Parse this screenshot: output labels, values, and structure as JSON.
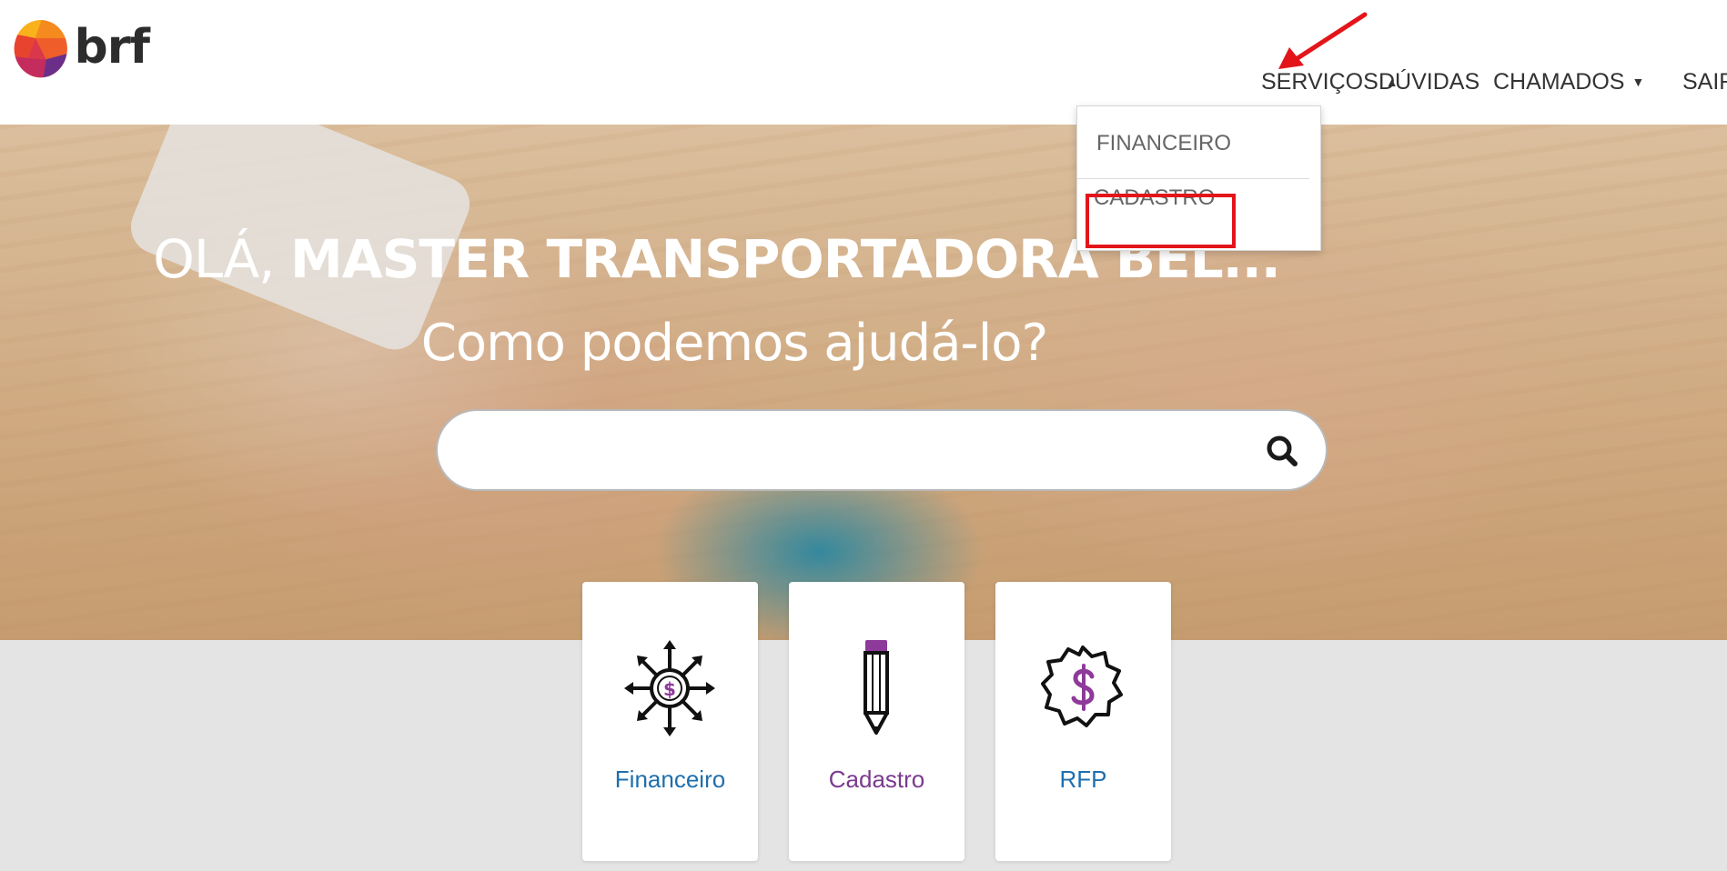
{
  "header": {
    "logo_text": "brf",
    "nav": {
      "servicos": "SERVIÇOS",
      "duvidas": "DÚVIDAS",
      "chamados": "CHAMADOS",
      "sair": "SAIR"
    }
  },
  "dropdown": {
    "items": [
      "FINANCEIRO",
      "CADASTRO"
    ],
    "highlighted_item": "CADASTRO"
  },
  "hero": {
    "greeting_prefix": "OLÁ,",
    "greeting_name": "MASTER TRANSPORTADORA BEL...",
    "subtitle": "Como podemos ajudá-lo?"
  },
  "search": {
    "value": "",
    "placeholder": ""
  },
  "cards": [
    {
      "label": "Financeiro",
      "icon": "money-network-icon",
      "color": "#1f6fae"
    },
    {
      "label": "Cadastro",
      "icon": "pencil-icon",
      "color": "#7b3a8e"
    },
    {
      "label": "RFP",
      "icon": "badge-dollar-icon",
      "color": "#1f6fae"
    }
  ],
  "colors": {
    "annotation_red": "#e3151a",
    "purple_accent": "#7b3a8e",
    "blue_accent": "#1f6fae"
  }
}
